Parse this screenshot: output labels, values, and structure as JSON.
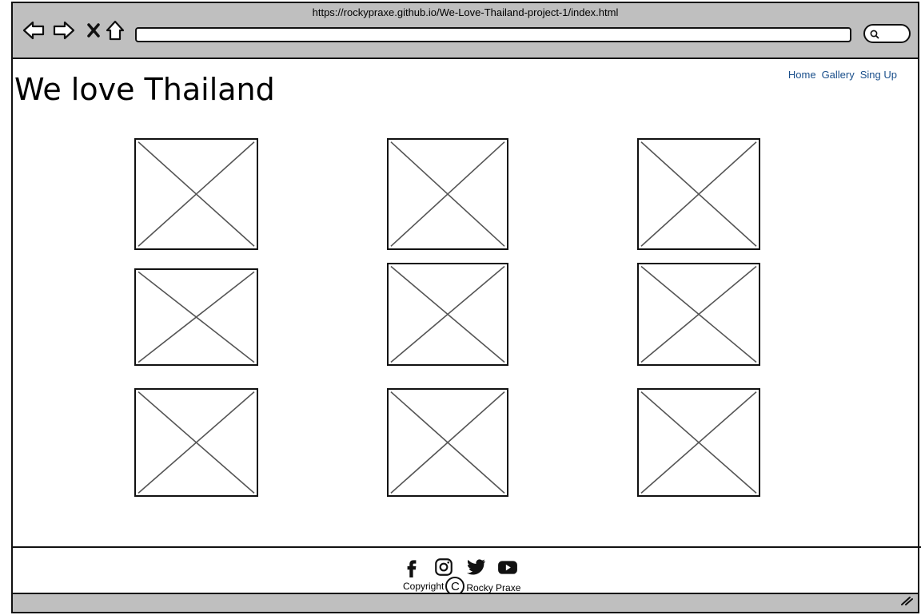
{
  "browser": {
    "url": "https://rockypraxe.github.io/We-Love-Thailand-project-1/index.html",
    "icons": [
      "back-arrow-icon",
      "forward-arrow-icon",
      "close-icon",
      "home-icon",
      "search-icon",
      "resize-grip-icon"
    ]
  },
  "header": {
    "title": "We love Thailand",
    "nav": [
      "Home",
      "Gallery",
      "Sing Up"
    ]
  },
  "gallery": {
    "image_count": 9
  },
  "footer": {
    "social_icons": [
      "facebook-icon",
      "instagram-icon",
      "twitter-icon",
      "youtube-icon"
    ],
    "copyright_label": "Copyright",
    "copyright_symbol": "C",
    "author": "Rocky Praxe"
  },
  "colors": {
    "chrome": "#bfbfbf",
    "link": "#1a4f8b"
  }
}
